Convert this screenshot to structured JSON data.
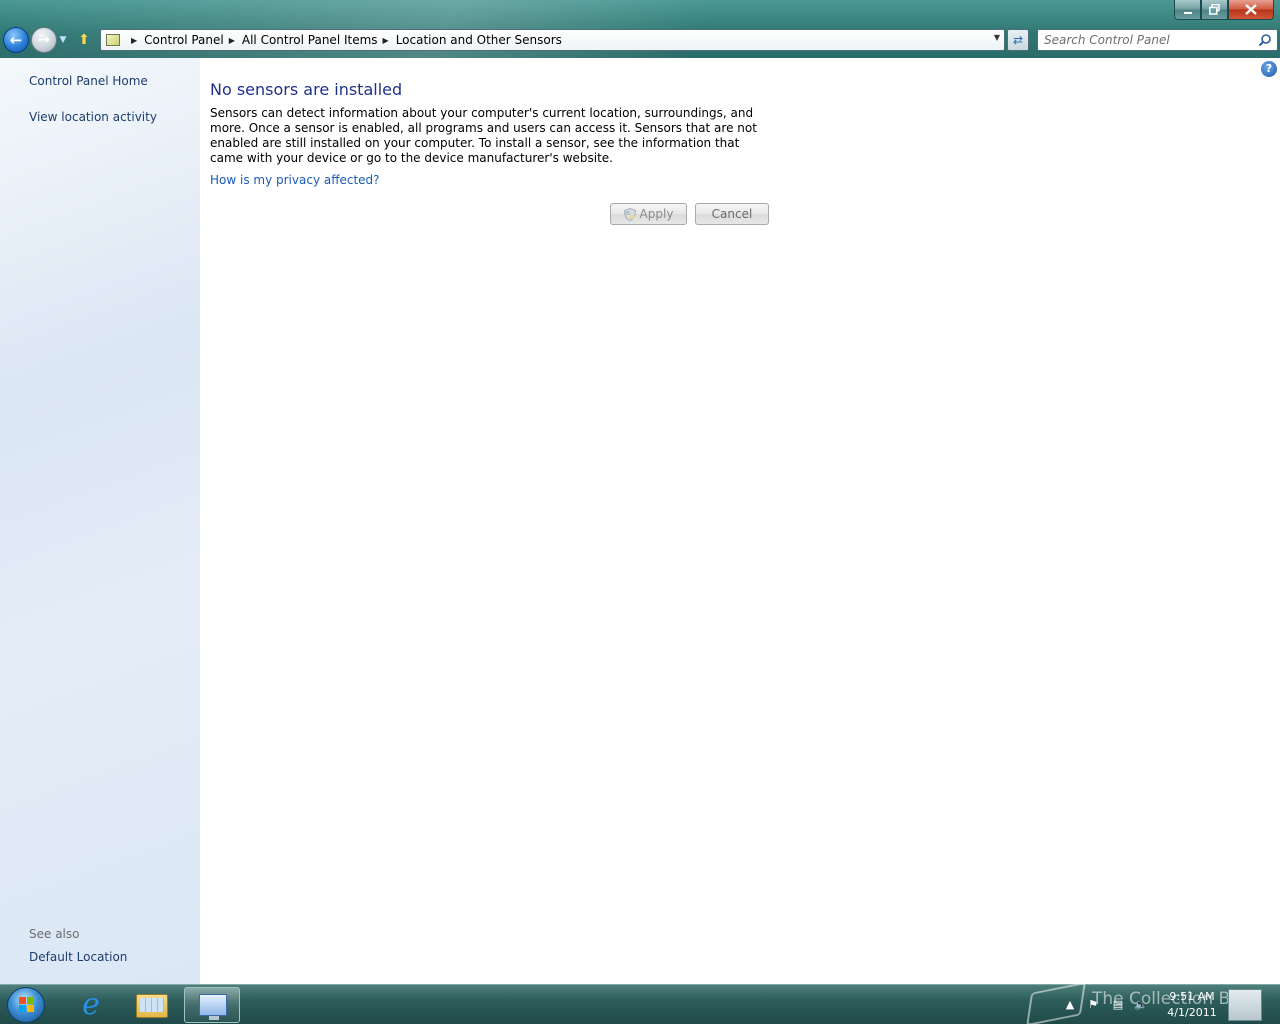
{
  "window": {
    "caption": {
      "minimize_icon": "minimize-icon",
      "maximize_icon": "restore-icon",
      "close_icon": "close-icon"
    }
  },
  "navigation": {
    "back_icon": "back-arrow-icon",
    "forward_icon": "forward-arrow-icon",
    "breadcrumb": [
      "Control Panel",
      "All Control Panel Items",
      "Location and Other Sensors"
    ],
    "search_placeholder": "Search Control Panel"
  },
  "sidebar": {
    "links": [
      "Control Panel Home",
      "View location activity"
    ],
    "see_also_label": "See also",
    "see_also_links": [
      "Default Location"
    ]
  },
  "main": {
    "title": "No sensors are installed",
    "description": "Sensors can detect information about your computer's current location, surroundings, and more. Once a sensor is enabled, all programs and users can access it. Sensors that are not enabled are still installed on your computer. To install a sensor, see the information that came with your device or go to the device manufacturer's website.",
    "privacy_link": "How is my privacy affected?",
    "apply_label": "Apply",
    "cancel_label": "Cancel"
  },
  "taskbar": {
    "pinned": [
      "internet-explorer-icon",
      "windows-explorer-icon",
      "control-panel-icon"
    ],
    "active_item": "control-panel-icon",
    "clock_time": "9:51 AM",
    "clock_date": "4/1/2011",
    "watermark": "The Collection Book"
  },
  "colors": {
    "accent": "#1e3287",
    "link": "#1a5bb4",
    "sidebar_link": "#1e3d6d"
  }
}
